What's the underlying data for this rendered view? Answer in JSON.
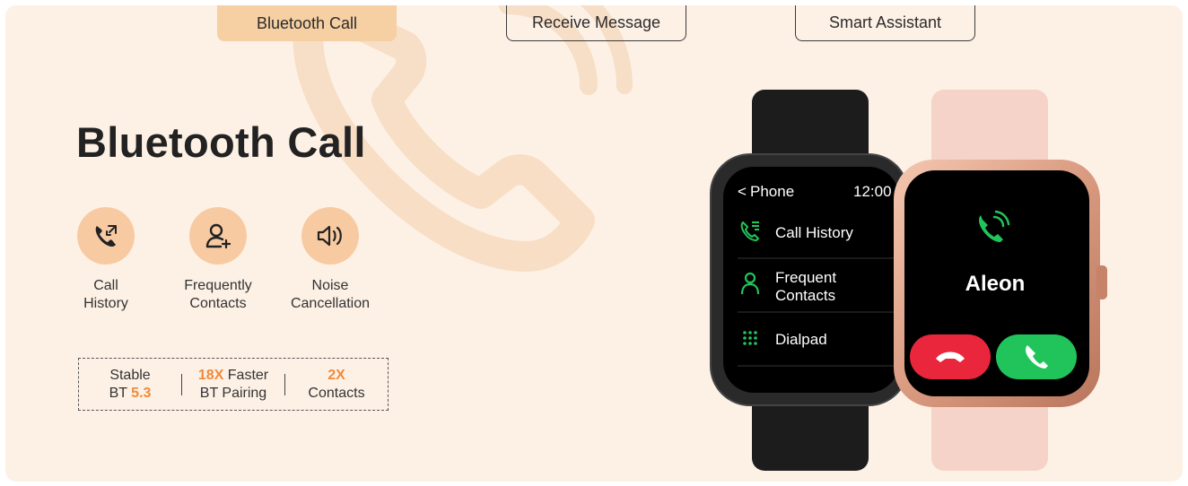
{
  "tabs": [
    {
      "label": "Bluetooth Call",
      "active": true
    },
    {
      "label": "Receive Message",
      "active": false
    },
    {
      "label": "Smart Assistant",
      "active": false
    }
  ],
  "hero": {
    "title": "Bluetooth Call"
  },
  "features": [
    {
      "icon": "phone-call-icon",
      "line1": "Call",
      "line2": "History"
    },
    {
      "icon": "add-contact-icon",
      "line1": "Frequently",
      "line2": "Contacts"
    },
    {
      "icon": "speaker-icon",
      "line1": "Noise",
      "line2": "Cancellation"
    }
  ],
  "stats": [
    {
      "line1": "Stable",
      "line2_prefix": "BT ",
      "line2_hl": "5.3"
    },
    {
      "line1_hl": "18X",
      "line1_suffix": " Faster",
      "line2": "BT Pairing"
    },
    {
      "line1_hl": "2X",
      "line2": "Contacts"
    }
  ],
  "black_watch": {
    "back_label": "Phone",
    "time": "12:00",
    "menu": [
      {
        "icon": "call-history-icon",
        "label": "Call History"
      },
      {
        "icon": "contact-icon",
        "label": "Frequent Contacts"
      },
      {
        "icon": "dialpad-icon",
        "label": "Dialpad"
      }
    ]
  },
  "pink_watch": {
    "caller": "Aleon"
  },
  "colors": {
    "accent": "#f08a3c",
    "tab_active": "#f6cfa3",
    "icon_circle": "#f8caa1",
    "panel": "#fdf1e6",
    "green": "#21c45a",
    "red": "#e9263c"
  }
}
